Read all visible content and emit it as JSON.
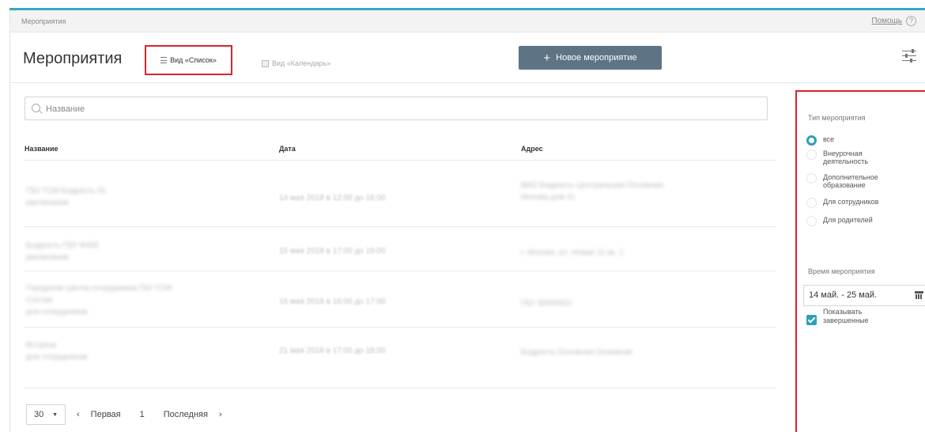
{
  "breadcrumb": "Мероприятия",
  "help": {
    "label": "Помощь",
    "icon": "question-icon"
  },
  "page_title": "Мероприятия",
  "views": {
    "list_label": "Вид «Список»",
    "calendar_label": "Вид «Календарь»"
  },
  "new_button": {
    "plus": "+",
    "label": "Новое мероприятие"
  },
  "search": {
    "placeholder": "Название"
  },
  "table": {
    "headers": [
      "Название",
      "Дата",
      "Адрес"
    ],
    "rows": [
      {
        "name": [
          "ГБУ ГСМ Бодрость 01",
          "расписание"
        ],
        "date": "14 мая 2018 в 12:00 до 16:00",
        "address": [
          "ВАО Бодрость Центральная Основная",
          "Москва дом 11"
        ]
      },
      {
        "name": [
          "Бодрость ГБУ Ф003",
          "расписание"
        ],
        "date": "15 мая 2018 в 17:00 до 19:00",
        "address": [
          "г. Москва, ул. Новая 11 кв. 1"
        ]
      },
      {
        "name": [
          "Городская школа сотрудников ГБУ ГСМ",
          "Состав",
          "для сотрудников"
        ],
        "date": "16 мая 2018 в 16:00 до 17:00",
        "address": [
          "ГБУ 30000011"
        ]
      },
      {
        "name": [
          "Встреча",
          "для сотрудников"
        ],
        "date": "21 мая 2018 в 17:00 до 18:00",
        "address": [
          "Бодрость Основная Основная"
        ]
      }
    ]
  },
  "pager": {
    "page_size": "30",
    "first": "Первая",
    "current": "1",
    "last": "Последняя",
    "prev_icon": "‹",
    "next_icon": "›"
  },
  "sidebar": {
    "type_title": "Тип мероприятия",
    "types": [
      {
        "label": "все",
        "selected": true
      },
      {
        "label": "Внеурочная деятельность",
        "selected": false
      },
      {
        "label": "Дополнительное образование",
        "selected": false
      },
      {
        "label": "Для сотрудников",
        "selected": false
      },
      {
        "label": "Для родителей",
        "selected": false
      }
    ],
    "time_title": "Время мероприятия",
    "date_range": "14 май. - 25 май.",
    "show_finished": "Показывать завершенные",
    "show_finished_checked": true
  },
  "colors": {
    "accent": "#2f9fb7",
    "button": "#5e7485",
    "highlight": "#d9232d"
  }
}
